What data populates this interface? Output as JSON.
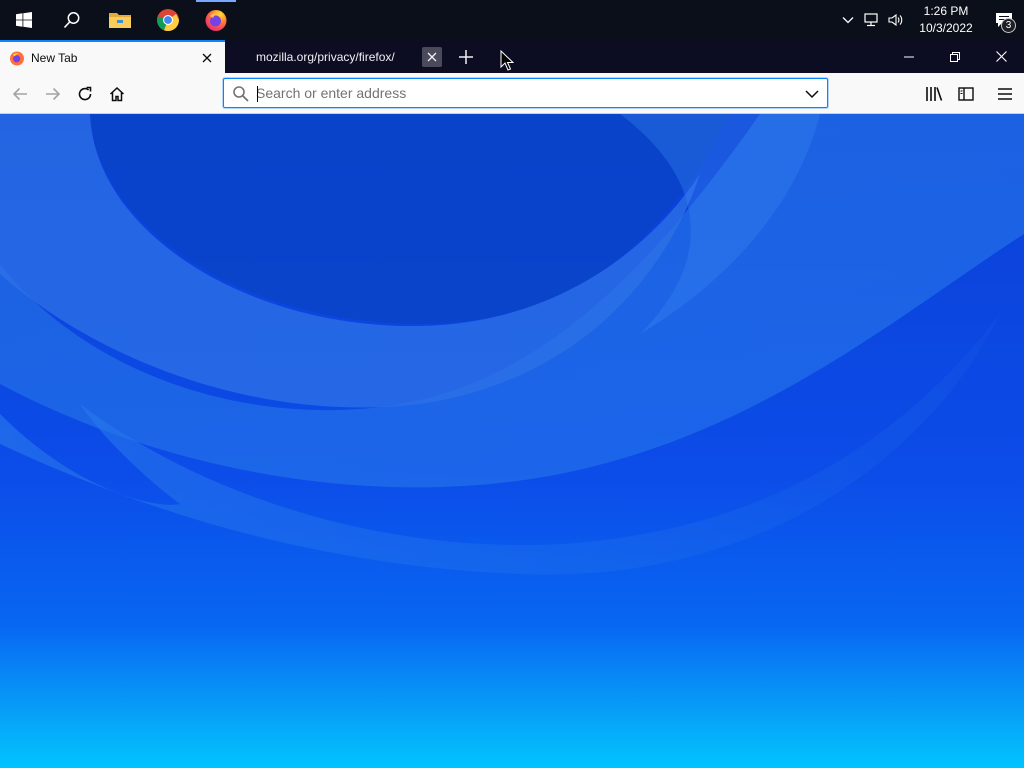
{
  "taskbar": {
    "start_icon": "windows-logo-icon",
    "search_icon": "search-icon",
    "pinned": [
      {
        "name": "file-explorer-icon"
      },
      {
        "name": "chrome-icon"
      },
      {
        "name": "firefox-icon",
        "active": true
      }
    ],
    "tray": {
      "overflow_icon": "chevron-up-icon",
      "network_icon": "network-icon",
      "volume_icon": "volume-icon",
      "time": "1:26 PM",
      "date": "10/3/2022",
      "notification_count": "3"
    }
  },
  "browser": {
    "tabs": [
      {
        "label": "New Tab",
        "selected": true
      },
      {
        "label": "mozilla.org/privacy/firefox/",
        "selected": false
      }
    ],
    "urlbar": {
      "placeholder": "Search or enter address",
      "value": ""
    }
  },
  "colors": {
    "accent": "#0a84ff",
    "tabstrip": "#0c0c22",
    "toolbar": "#f9f9fa"
  }
}
